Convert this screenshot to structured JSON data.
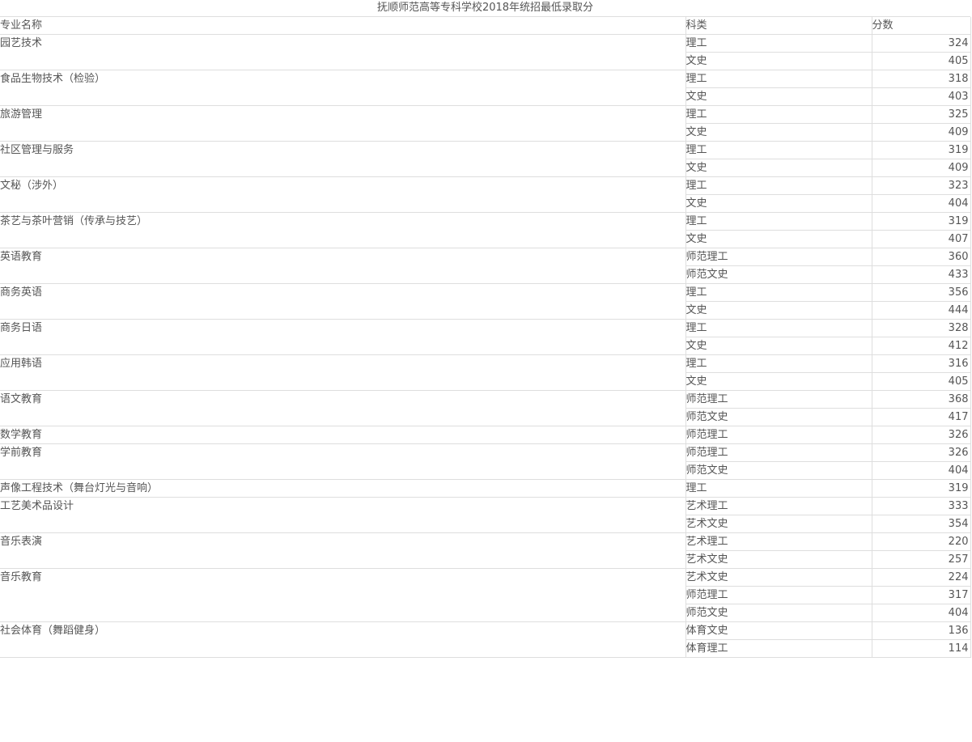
{
  "title": "抚顺师范高等专科学校2018年统招最低录取分",
  "headers": {
    "major": "专业名称",
    "category": "科类",
    "score": "分数"
  },
  "groups": [
    {
      "major": "园艺技术",
      "rows": [
        {
          "category": "理工",
          "score": "324"
        },
        {
          "category": "文史",
          "score": "405"
        }
      ]
    },
    {
      "major": "食品生物技术（检验）",
      "rows": [
        {
          "category": "理工",
          "score": "318"
        },
        {
          "category": "文史",
          "score": "403"
        }
      ]
    },
    {
      "major": "旅游管理",
      "rows": [
        {
          "category": "理工",
          "score": "325"
        },
        {
          "category": "文史",
          "score": "409"
        }
      ]
    },
    {
      "major": "社区管理与服务",
      "rows": [
        {
          "category": "理工",
          "score": "319"
        },
        {
          "category": "文史",
          "score": "409"
        }
      ]
    },
    {
      "major": "文秘（涉外）",
      "rows": [
        {
          "category": "理工",
          "score": "323"
        },
        {
          "category": "文史",
          "score": "404"
        }
      ]
    },
    {
      "major": "茶艺与茶叶营销（传承与技艺）",
      "rows": [
        {
          "category": "理工",
          "score": "319"
        },
        {
          "category": "文史",
          "score": "407"
        }
      ]
    },
    {
      "major": "英语教育",
      "rows": [
        {
          "category": "师范理工",
          "score": "360"
        },
        {
          "category": "师范文史",
          "score": "433"
        }
      ]
    },
    {
      "major": "商务英语",
      "rows": [
        {
          "category": "理工",
          "score": "356"
        },
        {
          "category": "文史",
          "score": "444"
        }
      ]
    },
    {
      "major": "商务日语",
      "rows": [
        {
          "category": "理工",
          "score": "328"
        },
        {
          "category": "文史",
          "score": "412"
        }
      ]
    },
    {
      "major": "应用韩语",
      "rows": [
        {
          "category": "理工",
          "score": "316"
        },
        {
          "category": "文史",
          "score": "405"
        }
      ]
    },
    {
      "major": "语文教育",
      "rows": [
        {
          "category": "师范理工",
          "score": "368"
        },
        {
          "category": "师范文史",
          "score": "417"
        }
      ]
    },
    {
      "major": "数学教育",
      "rows": [
        {
          "category": "师范理工",
          "score": "326"
        }
      ]
    },
    {
      "major": "学前教育",
      "rows": [
        {
          "category": "师范理工",
          "score": "326"
        },
        {
          "category": "师范文史",
          "score": "404"
        }
      ]
    },
    {
      "major": "声像工程技术（舞台灯光与音响）",
      "rows": [
        {
          "category": "理工",
          "score": "319"
        }
      ]
    },
    {
      "major": "工艺美术品设计",
      "rows": [
        {
          "category": "艺术理工",
          "score": "333"
        },
        {
          "category": "艺术文史",
          "score": "354"
        }
      ]
    },
    {
      "major": "音乐表演",
      "rows": [
        {
          "category": "艺术理工",
          "score": "220"
        },
        {
          "category": "艺术文史",
          "score": "257"
        }
      ]
    },
    {
      "major": "音乐教育",
      "rows": [
        {
          "category": "艺术文史",
          "score": "224"
        },
        {
          "category": "师范理工",
          "score": "317"
        },
        {
          "category": "师范文史",
          "score": "404"
        }
      ]
    },
    {
      "major": "社会体育（舞蹈健身）",
      "rows": [
        {
          "category": "体育文史",
          "score": "136"
        },
        {
          "category": "体育理工",
          "score": "114"
        }
      ]
    }
  ]
}
